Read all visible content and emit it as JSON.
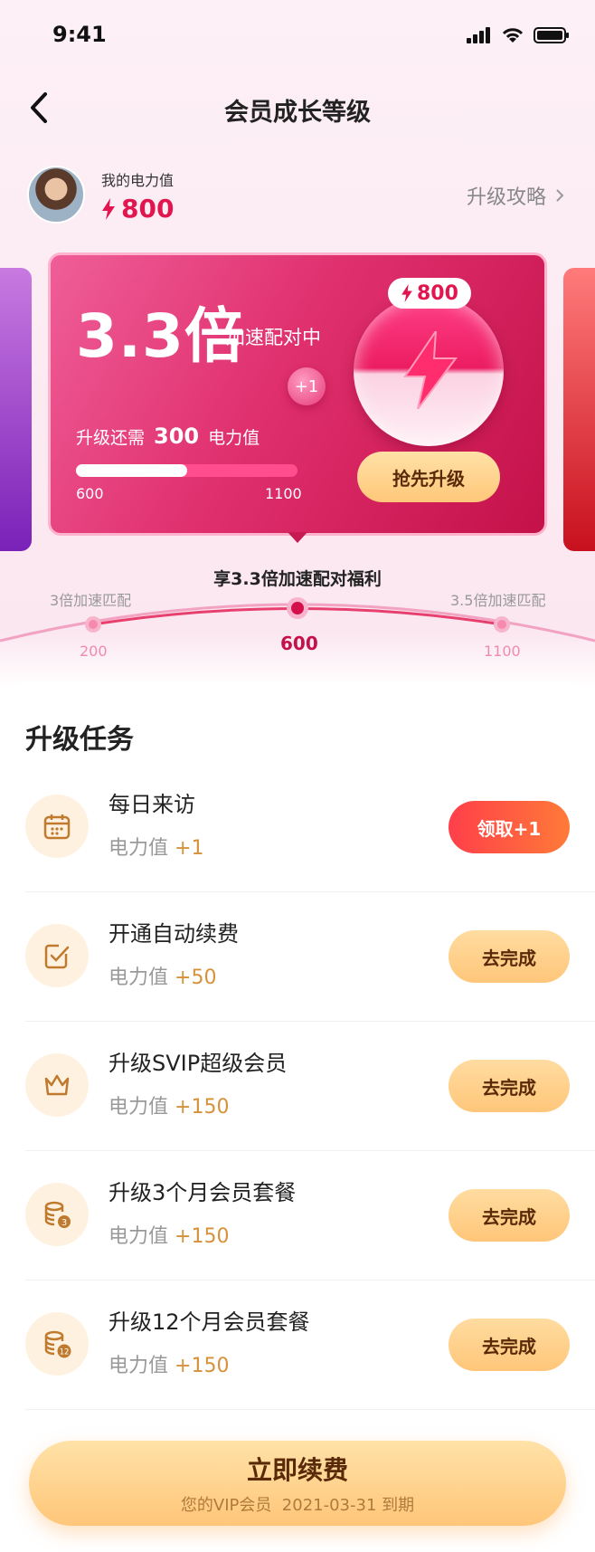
{
  "status_bar": {
    "time": "9:41"
  },
  "nav": {
    "title": "会员成长等级"
  },
  "profile": {
    "label": "我的电力值",
    "value": "800",
    "strategy": "升级攻略"
  },
  "card": {
    "multiplier": "3.3倍",
    "subtitle": "加速配对中",
    "need_prefix": "升级还需",
    "need_value": "300",
    "need_suffix": "电力值",
    "progress": 0.5,
    "bar_min": "600",
    "bar_max": "1100",
    "badge_value": "800",
    "plus": "+1",
    "button": "抢先升级"
  },
  "timeline": {
    "title": "享3.3倍加速配对福利",
    "left_label": "3倍加速匹配",
    "right_label": "3.5倍加速匹配",
    "v1": "200",
    "v2": "600",
    "v3": "1100"
  },
  "tasks_title": "升级任务",
  "reward_label": "电力值",
  "tasks": [
    {
      "name": "每日来访",
      "reward": "+1",
      "button": "领取+1",
      "icon": "calendar-icon"
    },
    {
      "name": "开通自动续费",
      "reward": "+50",
      "button": "去完成",
      "icon": "checkbox-icon"
    },
    {
      "name": "升级SVIP超级会员",
      "reward": "+150",
      "button": "去完成",
      "icon": "crown-icon"
    },
    {
      "name": "升级3个月会员套餐",
      "reward": "+150",
      "button": "去完成",
      "icon": "coins-3-icon"
    },
    {
      "name": "升级12个月会员套餐",
      "reward": "+150",
      "button": "去完成",
      "icon": "coins-12-icon"
    }
  ],
  "cta": {
    "main": "立即续费",
    "sub": "您的VIP会员  2021-03-31 到期"
  },
  "colors": {
    "brand": "#e2164f",
    "gold": "#ffc67a"
  }
}
